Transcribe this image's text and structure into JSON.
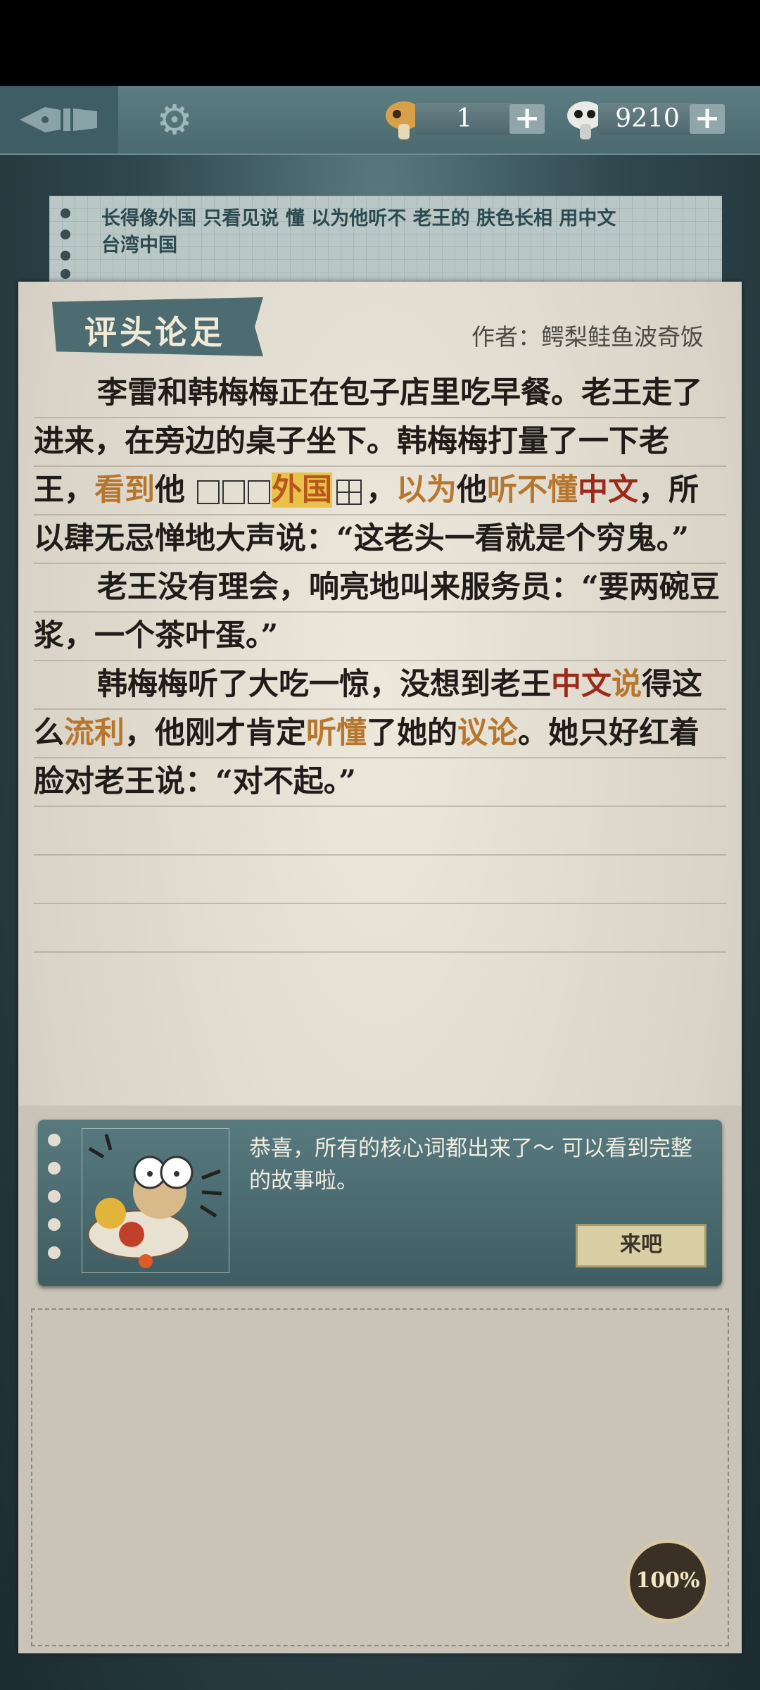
{
  "topbar": {
    "counter1": "1",
    "counter2": "9210",
    "plus": "+"
  },
  "hint": {
    "line1": "长得像外国 只看见说 懂 以为他听不 老王的 肤色长相 用中文",
    "line2": "台湾中国"
  },
  "title_tag": "评头论足",
  "author": "作者：鳄梨鲑鱼波奇饭",
  "story": {
    "p1a": "李雷和韩梅梅正在包子店里吃早餐。老王走了进来，在旁边的桌子坐下。韩梅梅打量了一下老王，",
    "p1b": "看到",
    "p1c": "他",
    "p1d": "外国",
    "p1e": "，",
    "p1f": "以为",
    "p1g": "他",
    "p1h": "听不懂",
    "p1i": "中文",
    "p1j": "，所以肆无忌惮地大声说：“这老头一看就是个穷鬼。”",
    "p2": "老王没有理会，响亮地叫来服务员：“要两碗豆浆，一个茶叶蛋。”",
    "p3a": "韩梅梅听了大吃一惊，没想到老王",
    "p3b": "中文",
    "p3c": "说",
    "p3d": "得这么",
    "p3e": "流利",
    "p3f": "，他刚才肯定",
    "p3g": "听懂",
    "p3h": "了她的",
    "p3i": "议论",
    "p3j": "。她只好红着脸对老王说：“对不起。”"
  },
  "dialog": {
    "text": "恭喜，所有的核心词都出来了～ 可以看到完整的故事啦。",
    "button": "来吧"
  },
  "progress": "100%",
  "icons": [
    "pen-icon",
    "gear-icon",
    "mushroom-icon",
    "panda-mushroom-icon"
  ]
}
